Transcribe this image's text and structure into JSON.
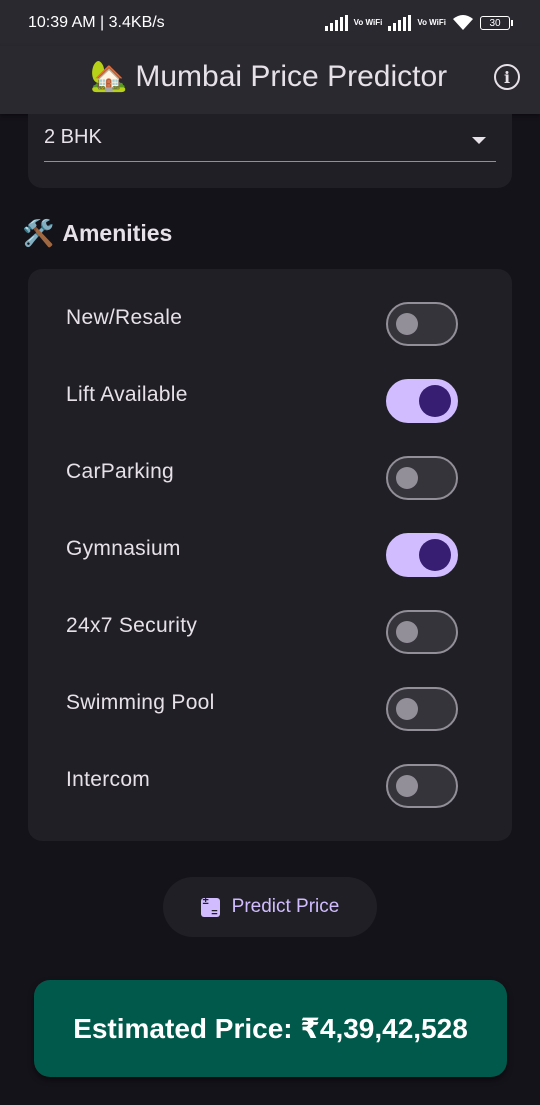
{
  "status_bar": {
    "time_speed": "10:39 AM | 3.4KB/s",
    "volte_1": "Vo WiFi",
    "volte_2": "Vo WiFi",
    "battery": "30"
  },
  "app_bar": {
    "title": "Mumbai Price Predictor",
    "house_emoji": "🏡",
    "info_icon": "info-icon"
  },
  "bhk_dropdown": {
    "value": "2 BHK"
  },
  "amenities": {
    "title": "Amenities",
    "title_emoji": "🛠️",
    "items": [
      {
        "label": "New/Resale",
        "enabled": false
      },
      {
        "label": "Lift Available",
        "enabled": true
      },
      {
        "label": "CarParking",
        "enabled": false
      },
      {
        "label": "Gymnasium",
        "enabled": true
      },
      {
        "label": "24x7 Security",
        "enabled": false
      },
      {
        "label": "Swimming Pool",
        "enabled": false
      },
      {
        "label": "Intercom",
        "enabled": false
      }
    ]
  },
  "predict_button": {
    "label": "Predict Price",
    "icon": "calculate-icon"
  },
  "result": {
    "text": "Estimated Price: ₹4,39,42,528"
  },
  "colors": {
    "background": "#15131a",
    "surface": "#211f26",
    "accent": "#d0bcff",
    "result_bg": "#00594a"
  }
}
